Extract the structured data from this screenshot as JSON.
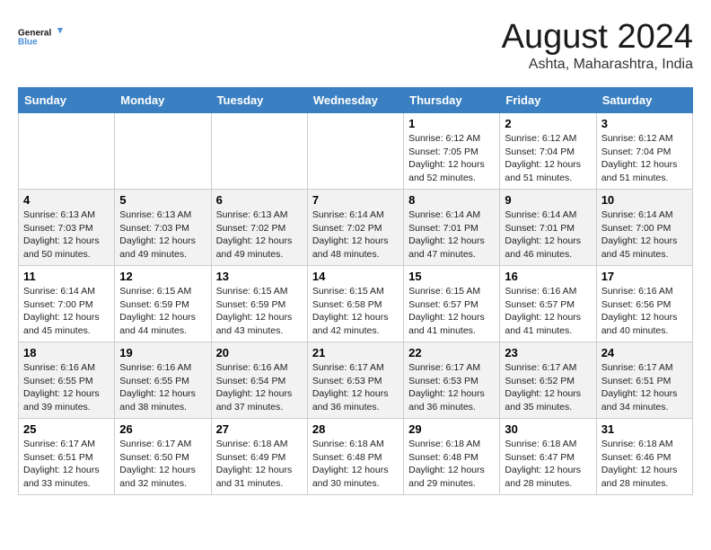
{
  "header": {
    "logo_line1": "General",
    "logo_line2": "Blue",
    "month": "August 2024",
    "location": "Ashta, Maharashtra, India"
  },
  "days_of_week": [
    "Sunday",
    "Monday",
    "Tuesday",
    "Wednesday",
    "Thursday",
    "Friday",
    "Saturday"
  ],
  "weeks": [
    [
      {
        "day": "",
        "info": ""
      },
      {
        "day": "",
        "info": ""
      },
      {
        "day": "",
        "info": ""
      },
      {
        "day": "",
        "info": ""
      },
      {
        "day": "1",
        "info": "Sunrise: 6:12 AM\nSunset: 7:05 PM\nDaylight: 12 hours and 52 minutes."
      },
      {
        "day": "2",
        "info": "Sunrise: 6:12 AM\nSunset: 7:04 PM\nDaylight: 12 hours and 51 minutes."
      },
      {
        "day": "3",
        "info": "Sunrise: 6:12 AM\nSunset: 7:04 PM\nDaylight: 12 hours and 51 minutes."
      }
    ],
    [
      {
        "day": "4",
        "info": "Sunrise: 6:13 AM\nSunset: 7:03 PM\nDaylight: 12 hours and 50 minutes."
      },
      {
        "day": "5",
        "info": "Sunrise: 6:13 AM\nSunset: 7:03 PM\nDaylight: 12 hours and 49 minutes."
      },
      {
        "day": "6",
        "info": "Sunrise: 6:13 AM\nSunset: 7:02 PM\nDaylight: 12 hours and 49 minutes."
      },
      {
        "day": "7",
        "info": "Sunrise: 6:14 AM\nSunset: 7:02 PM\nDaylight: 12 hours and 48 minutes."
      },
      {
        "day": "8",
        "info": "Sunrise: 6:14 AM\nSunset: 7:01 PM\nDaylight: 12 hours and 47 minutes."
      },
      {
        "day": "9",
        "info": "Sunrise: 6:14 AM\nSunset: 7:01 PM\nDaylight: 12 hours and 46 minutes."
      },
      {
        "day": "10",
        "info": "Sunrise: 6:14 AM\nSunset: 7:00 PM\nDaylight: 12 hours and 45 minutes."
      }
    ],
    [
      {
        "day": "11",
        "info": "Sunrise: 6:14 AM\nSunset: 7:00 PM\nDaylight: 12 hours and 45 minutes."
      },
      {
        "day": "12",
        "info": "Sunrise: 6:15 AM\nSunset: 6:59 PM\nDaylight: 12 hours and 44 minutes."
      },
      {
        "day": "13",
        "info": "Sunrise: 6:15 AM\nSunset: 6:59 PM\nDaylight: 12 hours and 43 minutes."
      },
      {
        "day": "14",
        "info": "Sunrise: 6:15 AM\nSunset: 6:58 PM\nDaylight: 12 hours and 42 minutes."
      },
      {
        "day": "15",
        "info": "Sunrise: 6:15 AM\nSunset: 6:57 PM\nDaylight: 12 hours and 41 minutes."
      },
      {
        "day": "16",
        "info": "Sunrise: 6:16 AM\nSunset: 6:57 PM\nDaylight: 12 hours and 41 minutes."
      },
      {
        "day": "17",
        "info": "Sunrise: 6:16 AM\nSunset: 6:56 PM\nDaylight: 12 hours and 40 minutes."
      }
    ],
    [
      {
        "day": "18",
        "info": "Sunrise: 6:16 AM\nSunset: 6:55 PM\nDaylight: 12 hours and 39 minutes."
      },
      {
        "day": "19",
        "info": "Sunrise: 6:16 AM\nSunset: 6:55 PM\nDaylight: 12 hours and 38 minutes."
      },
      {
        "day": "20",
        "info": "Sunrise: 6:16 AM\nSunset: 6:54 PM\nDaylight: 12 hours and 37 minutes."
      },
      {
        "day": "21",
        "info": "Sunrise: 6:17 AM\nSunset: 6:53 PM\nDaylight: 12 hours and 36 minutes."
      },
      {
        "day": "22",
        "info": "Sunrise: 6:17 AM\nSunset: 6:53 PM\nDaylight: 12 hours and 36 minutes."
      },
      {
        "day": "23",
        "info": "Sunrise: 6:17 AM\nSunset: 6:52 PM\nDaylight: 12 hours and 35 minutes."
      },
      {
        "day": "24",
        "info": "Sunrise: 6:17 AM\nSunset: 6:51 PM\nDaylight: 12 hours and 34 minutes."
      }
    ],
    [
      {
        "day": "25",
        "info": "Sunrise: 6:17 AM\nSunset: 6:51 PM\nDaylight: 12 hours and 33 minutes."
      },
      {
        "day": "26",
        "info": "Sunrise: 6:17 AM\nSunset: 6:50 PM\nDaylight: 12 hours and 32 minutes."
      },
      {
        "day": "27",
        "info": "Sunrise: 6:18 AM\nSunset: 6:49 PM\nDaylight: 12 hours and 31 minutes."
      },
      {
        "day": "28",
        "info": "Sunrise: 6:18 AM\nSunset: 6:48 PM\nDaylight: 12 hours and 30 minutes."
      },
      {
        "day": "29",
        "info": "Sunrise: 6:18 AM\nSunset: 6:48 PM\nDaylight: 12 hours and 29 minutes."
      },
      {
        "day": "30",
        "info": "Sunrise: 6:18 AM\nSunset: 6:47 PM\nDaylight: 12 hours and 28 minutes."
      },
      {
        "day": "31",
        "info": "Sunrise: 6:18 AM\nSunset: 6:46 PM\nDaylight: 12 hours and 28 minutes."
      }
    ]
  ]
}
